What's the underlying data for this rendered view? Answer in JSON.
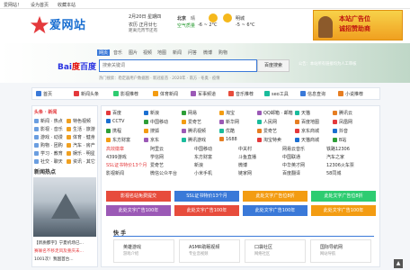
{
  "topbar": {
    "welcome": "爱网站！",
    "login": "设为首页",
    "favorite": "收藏本站"
  },
  "header": {
    "logo": "爱网站",
    "date": "2月20日 星期四",
    "lunar": "农历 正月廿七",
    "holiday": "距离元宵节还有",
    "city1": "北京",
    "city1_weather": "晴",
    "city1_temp": "-6 ~ 2°C",
    "city1_aqi": "空气质量",
    "city2": "明城",
    "city2_weather": "晴",
    "city2_temp": "-5 ~ 6°C",
    "banner_line1": "本站广告位",
    "banner_line2": "诚招赞助商"
  },
  "search": {
    "tabs": [
      "网页",
      "音乐",
      "图片",
      "视频",
      "地图",
      "新闻",
      "问答",
      "微博",
      "购物"
    ],
    "placeholder": "搜索关键词",
    "button": "百度搜索",
    "hot": "热门搜索：稳定器用户数据图 · 新冠疫苗 · 2020年 · 南方 · 冬奥 · 疫情",
    "notice": "公告：本站所有链接均为人工审核"
  },
  "nav": {
    "items": [
      "首页",
      "新闻头条",
      "影视推荐",
      "体育新闻",
      "军事频道",
      "音乐推荐",
      "seo工具",
      "信息查询",
      "小说推荐"
    ]
  },
  "left": {
    "head": "头条 · 新闻",
    "rows": [
      [
        "新闻 · 热点",
        "特色视频"
      ],
      [
        "影视 · 音乐",
        "生活 · 旅游"
      ],
      [
        "游戏 · 动漫",
        "体育 · 健身"
      ],
      [
        "购物 · 团购",
        "汽车 · 房产"
      ],
      [
        "学习 · 教育",
        "娱乐 · 明星"
      ],
      [
        "社交 · 聊天",
        "资讯 · 其它"
      ]
    ],
    "news_head": "新闻热点",
    "news": [
      "【新质都字】宁夏机场已...",
      "赛联名不移走风及重庆未...",
      "1001次！我国首台..."
    ]
  },
  "sites": [
    [
      "百度",
      "新浪",
      "网易",
      "淘宝",
      "QQ邮箱 · 邮箱",
      "天猫",
      "腾讯云"
    ],
    [
      "CCTV",
      "中国移动",
      "爱奇艺",
      "新华网",
      "人民网",
      "百度地图",
      "凤凰网"
    ],
    [
      "携程",
      "搜狐",
      "腾讯视频",
      "优酷",
      "爱奇艺",
      "京东商城",
      "抖音"
    ],
    [
      "东方财富",
      "京东",
      "腾讯游戏",
      "1688",
      "淘宝特卖",
      "天猫商城",
      "B站"
    ]
  ],
  "links": [
    [
      "高效徽章",
      "阿里云",
      "中国移动",
      "中关村",
      "网易云音乐",
      "铁路12306"
    ],
    [
      "4399游戏",
      "学信网",
      "东方财富",
      "斗鱼直播",
      "中国联通",
      "汽车之家"
    ],
    [
      "SSL证书特价13个月",
      "爱奇艺",
      "新浪",
      "微博",
      "中华英才网",
      "12306火车票"
    ],
    [
      "影视新闻",
      "微信公众平台",
      "小米手机",
      "链家网",
      "百度翻译",
      "58同城"
    ]
  ],
  "colorbtns": [
    {
      "label": "影视名站免费提交",
      "color": "#e74c3c"
    },
    {
      "label": "SSL证书特价13个月",
      "color": "#3a79d8"
    },
    {
      "label": "此处文字广告位8折",
      "color": "#f39c12"
    },
    {
      "label": "此处文字广告位8折",
      "color": "#2ecc71"
    },
    {
      "label": "此处文字广告100年",
      "color": "#9b59b6"
    },
    {
      "label": "此处文字广告100年",
      "color": "#e74c3c"
    },
    {
      "label": "此处文字广告100年",
      "color": "#3a79d8"
    },
    {
      "label": "此处文字广告100年",
      "color": "#f39c12"
    }
  ],
  "section": {
    "title": "快 手",
    "cards": [
      {
        "title": "英雄游戏",
        "sub": "游戏介绍"
      },
      {
        "title": "ASMR助眠视频",
        "sub": "专业音视频"
      },
      {
        "title": "口袋社区",
        "sub": "网络社区"
      },
      {
        "title": "国际导航网",
        "sub": "网站导航"
      }
    ]
  }
}
